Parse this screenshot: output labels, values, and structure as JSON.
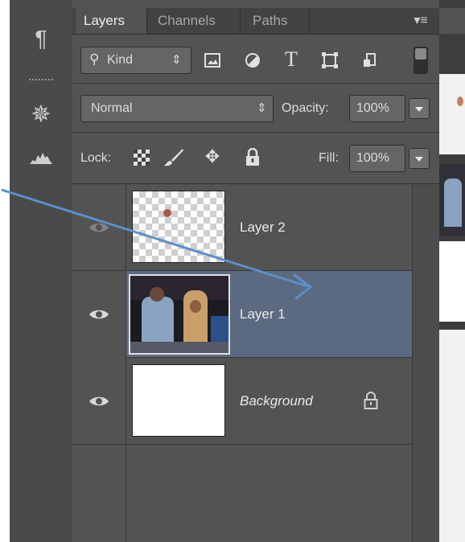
{
  "tabs": [
    {
      "label": "Layers",
      "active": true
    },
    {
      "label": "Channels",
      "active": false
    },
    {
      "label": "Paths",
      "active": false
    }
  ],
  "filter": {
    "kind_label": "Kind"
  },
  "blend": {
    "mode": "Normal",
    "opacity_label": "Opacity:",
    "opacity_value": "100%"
  },
  "lock": {
    "label": "Lock:",
    "fill_label": "Fill:",
    "fill_value": "100%"
  },
  "layers": [
    {
      "name": "Layer 2",
      "visible": false,
      "selected": false
    },
    {
      "name": "Layer 1",
      "visible": true,
      "selected": true
    },
    {
      "name": "Background",
      "visible": true,
      "selected": false,
      "locked": true
    }
  ],
  "colors": {
    "panel": "#535353",
    "selected_row": "#5b6a80",
    "arrow": "#5b8fc9"
  }
}
